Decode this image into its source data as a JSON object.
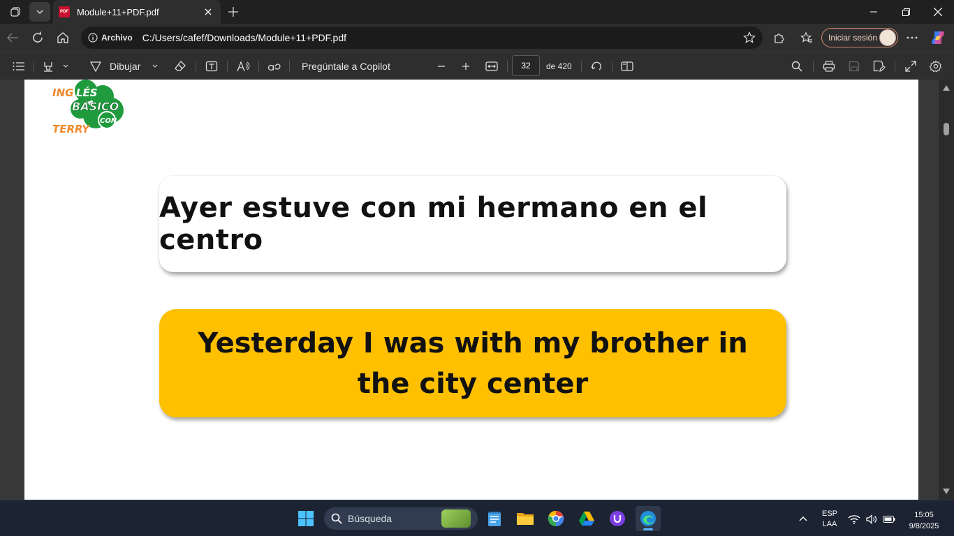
{
  "browser": {
    "tab_title": "Module+11+PDF.pdf",
    "tab_favicon": "PDF",
    "address_info": "Archivo",
    "url": "C:/Users/cafef/Downloads/Module+11+PDF.pdf",
    "signin_label": "Iniciar sesión"
  },
  "pdf_toolbar": {
    "draw_label": "Dibujar",
    "copilot_label": "Pregúntale a Copilot",
    "page_number": "32",
    "page_total": "de 420"
  },
  "document": {
    "logo_text": [
      "INGLÉS",
      "BÁSICO",
      "CON",
      "TERRY"
    ],
    "spanish_sentence": "Ayer estuve con mi hermano en el centro",
    "english_sentence": "Yesterday I was with my brother in the city center",
    "colors": {
      "highlight_card": "#fec001",
      "logo_green": "#1f9b3e",
      "logo_orange": "#f08a2c"
    }
  },
  "taskbar": {
    "search_placeholder": "Búsqueda",
    "language_top": "ESP",
    "language_bottom": "LAA",
    "time": "15:05",
    "date": "9/8/2025"
  }
}
